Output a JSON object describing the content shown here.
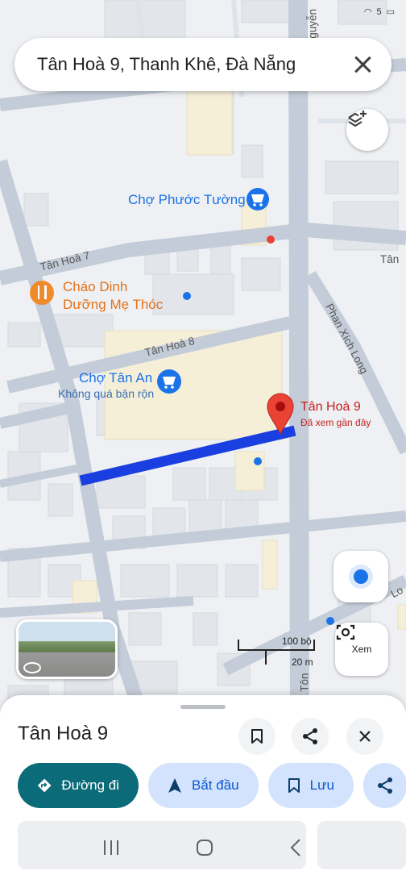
{
  "status": {
    "signal": "5"
  },
  "search": {
    "query": "Tân Hoà 9, Thanh Khê, Đà Nẵng"
  },
  "map": {
    "pois": {
      "cho_phuoc_tuong": "Chợ Phước Tường",
      "chao_dinh_line1": "Cháo Dinh",
      "chao_dinh_line2": "Dưỡng Mẹ Thóc",
      "cho_tan_an": "Chợ Tân An",
      "cho_tan_an_status": "Không quá bận rộn"
    },
    "pin": {
      "label": "Tân Hoà 9",
      "sublabel": "Đã xem gần đây"
    },
    "streets": {
      "tan_hoa_7": "Tân Hoà 7",
      "tan_hoa_8": "Tân Hoà 8",
      "phan_xich_long": "Phan Xích Long",
      "tan_right": "Tân",
      "thai_ton": "Thái Tôn",
      "top_vertical": "Nguyễn",
      "lo_right": "Lo"
    },
    "scale": {
      "imperial": "100 bộ",
      "metric": "20 m"
    }
  },
  "buttons": {
    "xem": "Xem"
  },
  "sheet": {
    "title": "Tân Hoà 9",
    "chips": {
      "directions": "Đường đi",
      "start": "Bắt đầu",
      "save": "Lưu"
    }
  },
  "colors": {
    "route": "#1a3fe0",
    "accent": "#0b6b79",
    "pin": "#ea4335"
  }
}
